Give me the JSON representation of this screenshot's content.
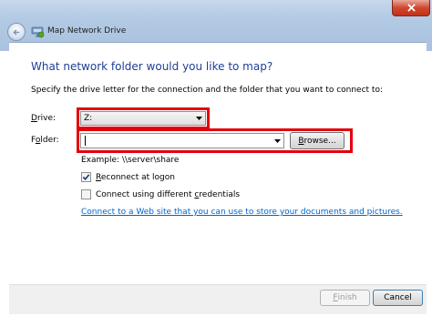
{
  "window": {
    "title": "Map Network Drive",
    "icon": "network-drive-icon",
    "close_icon": "close-icon",
    "back_icon": "back-arrow-icon"
  },
  "heading": "What network folder would you like to map?",
  "instructions": "Specify the drive letter for the connection and the folder that you want to connect to:",
  "drive": {
    "label_prefix": "",
    "label_access": "D",
    "label_rest": "rive:",
    "value": "Z:"
  },
  "folder": {
    "label_prefix": "F",
    "label_access": "o",
    "label_rest": "lder:",
    "value": "",
    "browse_label_access": "B",
    "browse_label_rest": "rowse..."
  },
  "example": "Example: \\\\server\\share",
  "options": {
    "reconnect": {
      "access": "R",
      "rest": "econnect at logon",
      "checked": true
    },
    "different_credentials": {
      "prefix": "Connect using different ",
      "access": "c",
      "rest": "redentials",
      "checked": false
    }
  },
  "link": "Connect to a Web site that you can use to store your documents and pictures.",
  "footer": {
    "finish_access": "F",
    "finish_rest": "inish",
    "cancel": "Cancel"
  },
  "colors": {
    "heading": "#1e3f96",
    "link": "#0066cc",
    "highlight": "#e3000b",
    "close": "#c13318"
  }
}
